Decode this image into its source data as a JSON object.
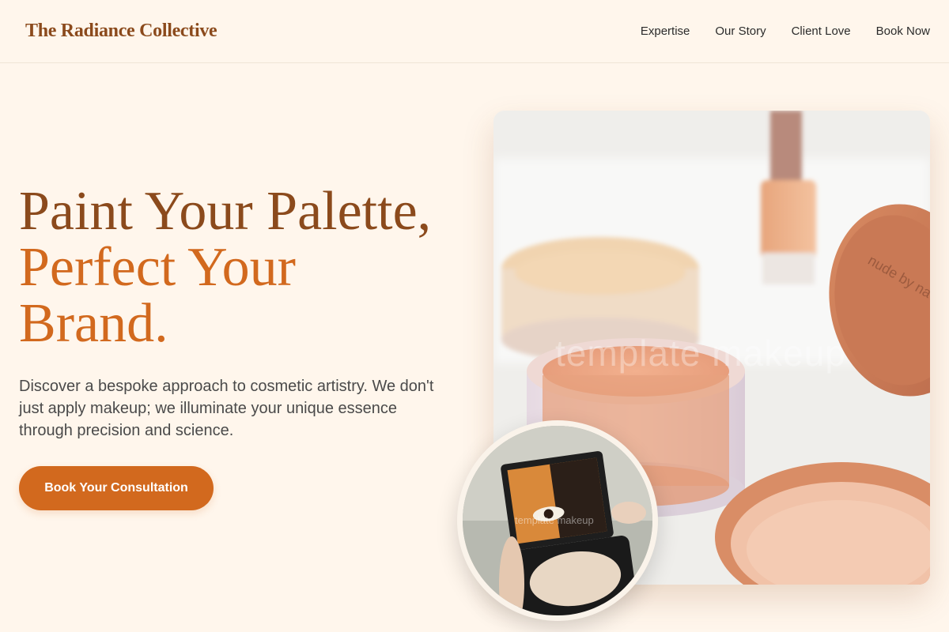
{
  "header": {
    "brand": "The Radiance Collective",
    "nav": [
      "Expertise",
      "Our Story",
      "Client Love",
      "Book Now"
    ]
  },
  "hero": {
    "title_line1": "Paint Your Palette,",
    "title_line2": "Perfect Your",
    "title_line3": "Brand.",
    "subtitle": "Discover a bespoke approach to cosmetic artistry. We don't just apply makeup; we illuminate your unique essence through precision and science.",
    "cta_label": "Book Your Consultation"
  },
  "images": {
    "main_watermark": "template makeup",
    "main_jar_text": "nude by na",
    "circle_watermark": "template makeup"
  },
  "colors": {
    "background": "#fff6ec",
    "brand_dark": "#8b4a1c",
    "accent": "#d2691e",
    "text": "#4a4a4a"
  }
}
